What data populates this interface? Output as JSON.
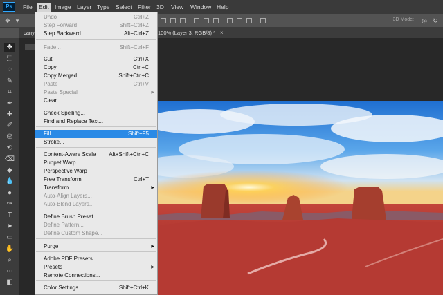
{
  "app": {
    "logo": "Ps"
  },
  "menubar": [
    "File",
    "Edit",
    "Image",
    "Layer",
    "Type",
    "Select",
    "Filter",
    "3D",
    "View",
    "Window",
    "Help"
  ],
  "options": {
    "mode3d": "3D Mode:"
  },
  "tabs": {
    "left": "cany",
    "right": "100% (Layer 3, RGB/8) *",
    "close": "×"
  },
  "edit_menu": {
    "items": [
      {
        "label": "Undo",
        "shortcut": "Ctrl+Z",
        "state": "disabled"
      },
      {
        "label": "Step Forward",
        "shortcut": "Shift+Ctrl+Z",
        "state": "disabled"
      },
      {
        "label": "Step Backward",
        "shortcut": "Alt+Ctrl+Z",
        "state": "normal"
      },
      {
        "label": "Fade...",
        "shortcut": "Shift+Ctrl+F",
        "state": "disabled"
      },
      {
        "label": "Cut",
        "shortcut": "Ctrl+X",
        "state": "normal"
      },
      {
        "label": "Copy",
        "shortcut": "Ctrl+C",
        "state": "normal"
      },
      {
        "label": "Copy Merged",
        "shortcut": "Shift+Ctrl+C",
        "state": "normal"
      },
      {
        "label": "Paste",
        "shortcut": "Ctrl+V",
        "state": "disabled"
      },
      {
        "label": "Paste Special",
        "shortcut": "",
        "state": "disabled",
        "submenu": true
      },
      {
        "label": "Clear",
        "shortcut": "",
        "state": "normal"
      },
      {
        "label": "Check Spelling...",
        "shortcut": "",
        "state": "normal"
      },
      {
        "label": "Find and Replace Text...",
        "shortcut": "",
        "state": "normal"
      },
      {
        "label": "Fill...",
        "shortcut": "Shift+F5",
        "state": "highlighted"
      },
      {
        "label": "Stroke...",
        "shortcut": "",
        "state": "normal"
      },
      {
        "label": "Content-Aware Scale",
        "shortcut": "Alt+Shift+Ctrl+C",
        "state": "normal"
      },
      {
        "label": "Puppet Warp",
        "shortcut": "",
        "state": "normal"
      },
      {
        "label": "Perspective Warp",
        "shortcut": "",
        "state": "normal"
      },
      {
        "label": "Free Transform",
        "shortcut": "Ctrl+T",
        "state": "normal"
      },
      {
        "label": "Transform",
        "shortcut": "",
        "state": "normal",
        "submenu": true
      },
      {
        "label": "Auto-Align Layers...",
        "shortcut": "",
        "state": "disabled"
      },
      {
        "label": "Auto-Blend Layers...",
        "shortcut": "",
        "state": "disabled"
      },
      {
        "label": "Define Brush Preset...",
        "shortcut": "",
        "state": "normal"
      },
      {
        "label": "Define Pattern...",
        "shortcut": "",
        "state": "disabled"
      },
      {
        "label": "Define Custom Shape...",
        "shortcut": "",
        "state": "disabled"
      },
      {
        "label": "Purge",
        "shortcut": "",
        "state": "normal",
        "submenu": true
      },
      {
        "label": "Adobe PDF Presets...",
        "shortcut": "",
        "state": "normal"
      },
      {
        "label": "Presets",
        "shortcut": "",
        "state": "normal",
        "submenu": true
      },
      {
        "label": "Remote Connections...",
        "shortcut": "",
        "state": "normal"
      },
      {
        "label": "Color Settings...",
        "shortcut": "Shift+Ctrl+K",
        "state": "normal"
      }
    ]
  },
  "tools": [
    "move-tool",
    "marquee-tool",
    "lasso-tool",
    "quick-select-tool",
    "crop-tool",
    "eyedropper-tool",
    "healing-brush-tool",
    "brush-tool",
    "clone-stamp-tool",
    "history-brush-tool",
    "eraser-tool",
    "paint-bucket-tool",
    "blur-tool",
    "dodge-tool",
    "pen-tool",
    "type-tool",
    "path-select-tool",
    "shape-tool",
    "hand-tool",
    "zoom-tool",
    "edit-toolbar-tool",
    "color-swatches"
  ],
  "colors": {
    "menu_bg": "#e9e9e9",
    "highlight": "#2a8ae6",
    "chrome_dark": "#3c3c3c",
    "chrome_mid": "#535353"
  }
}
